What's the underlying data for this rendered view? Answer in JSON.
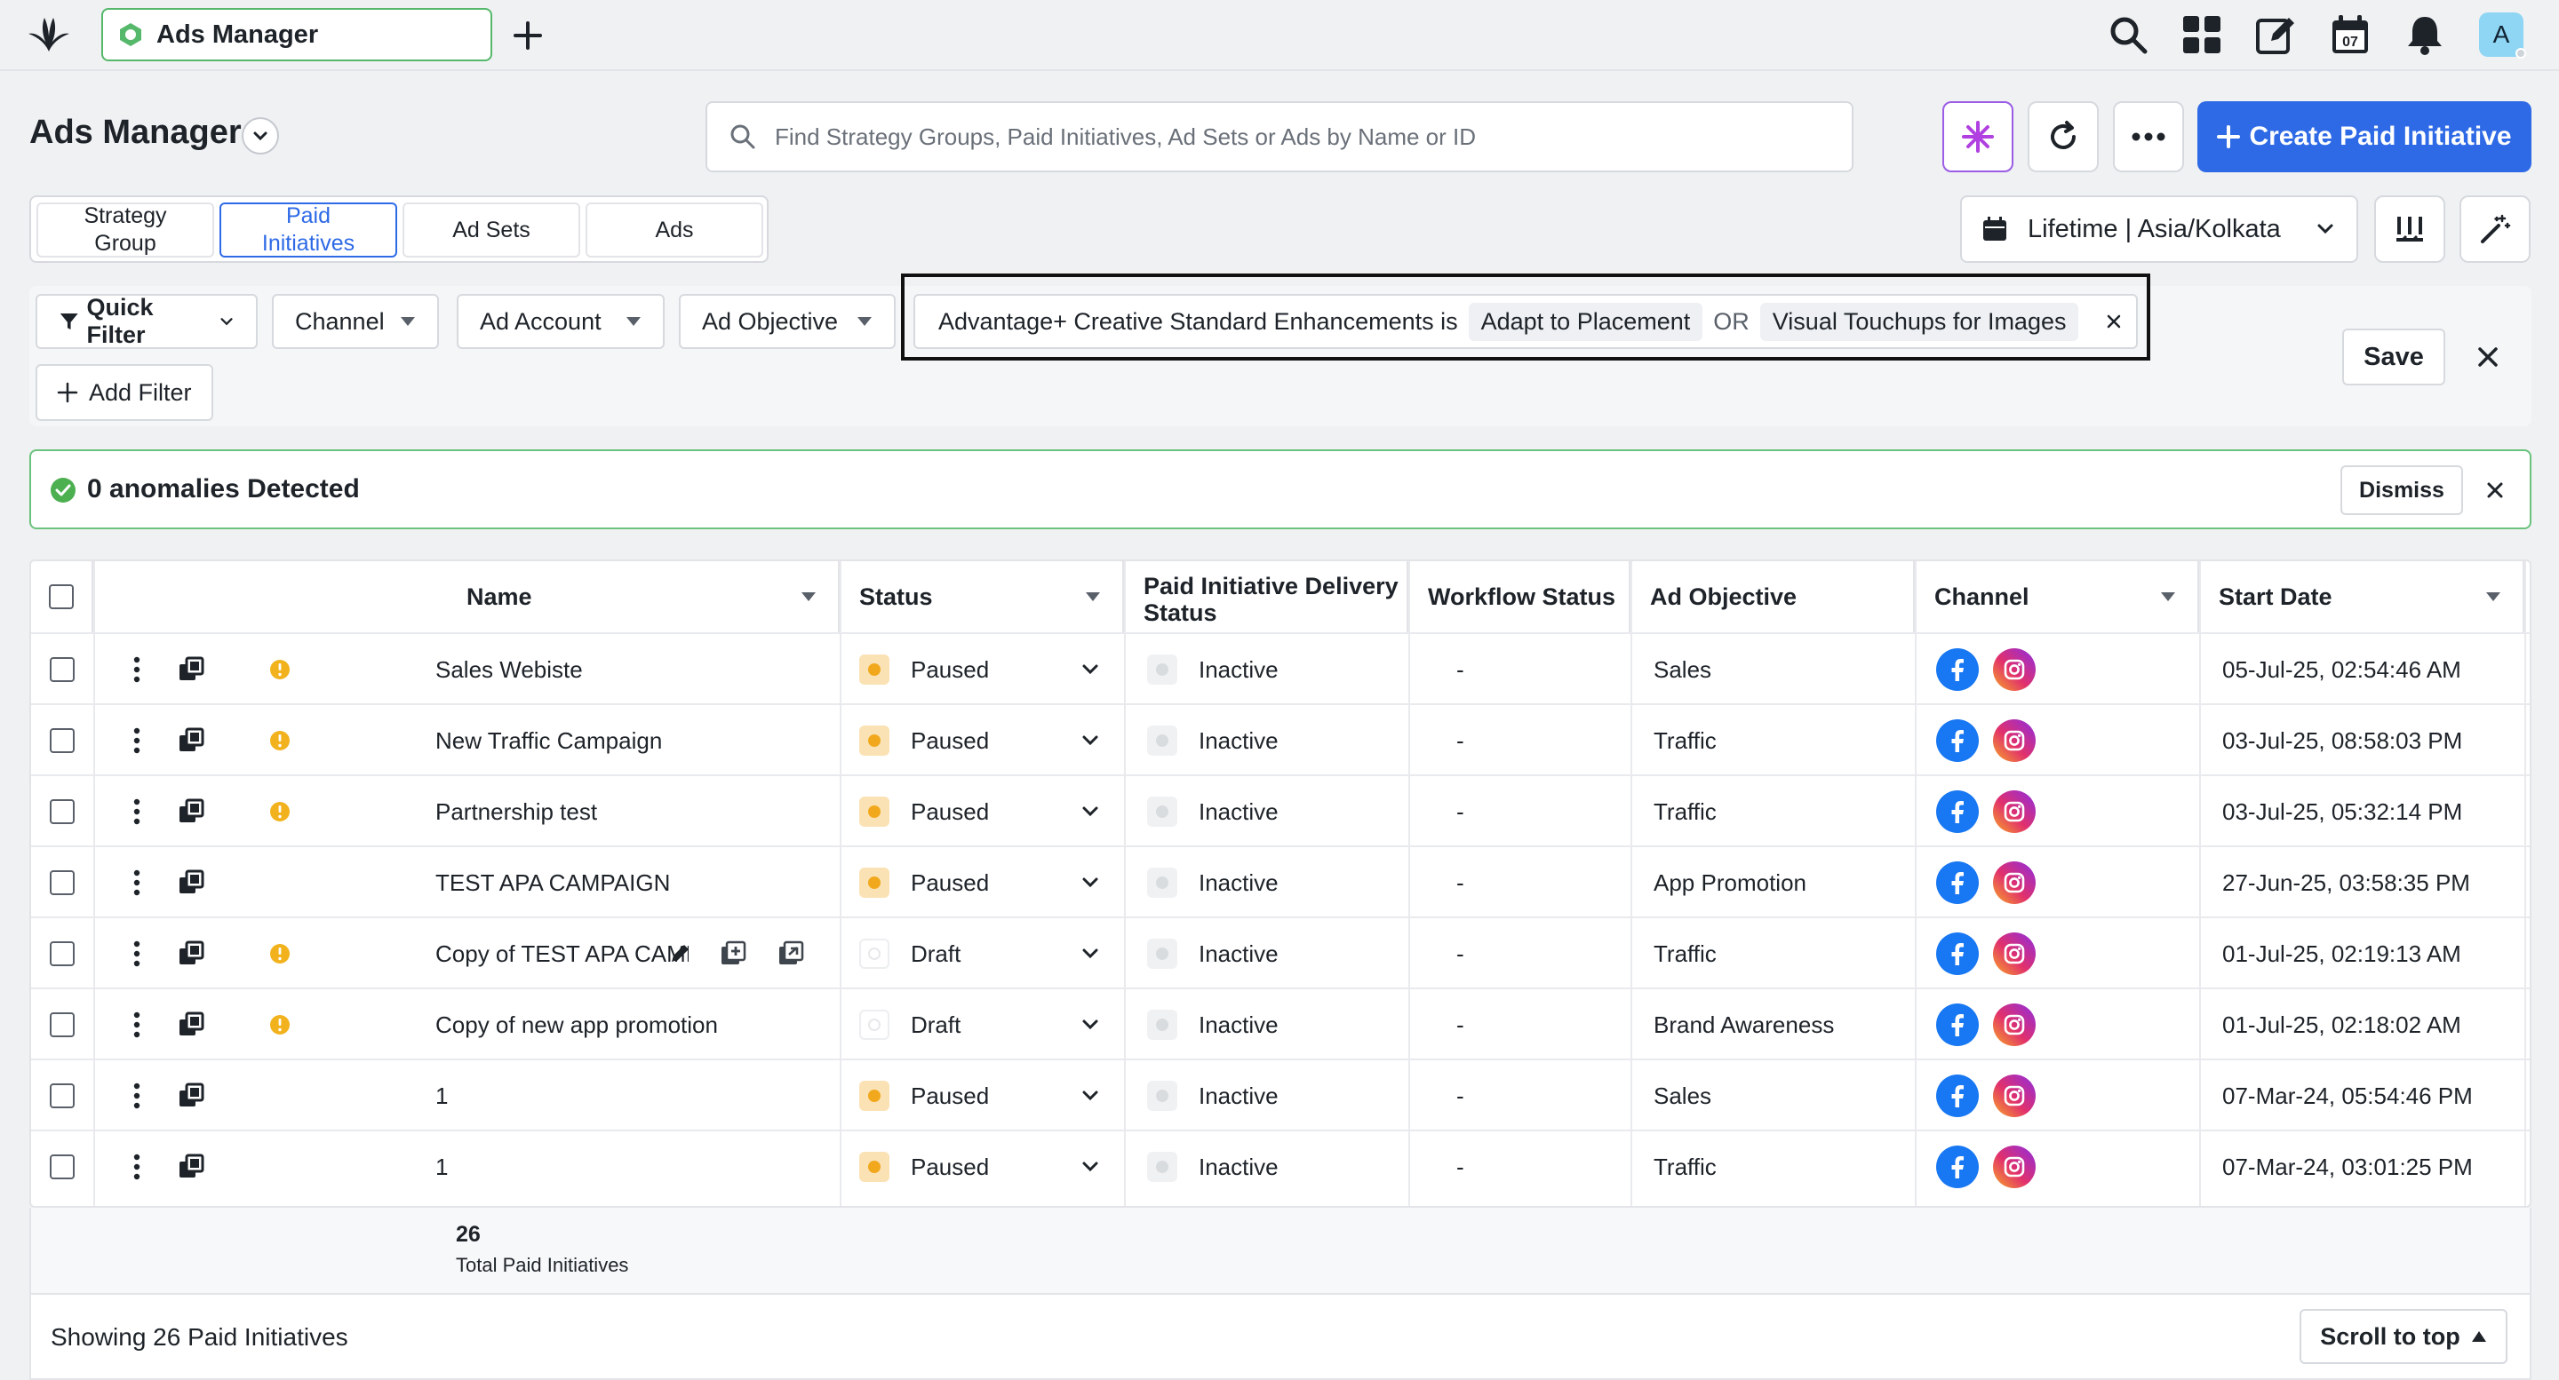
{
  "app": {
    "tab_title": "Ads Manager",
    "avatar_letter": "A",
    "calendar_day": "07"
  },
  "header": {
    "page_title": "Ads Manager",
    "search_placeholder": "Find Strategy Groups, Paid Initiatives, Ad Sets or Ads by Name or ID",
    "create_label": "Create Paid Initiative"
  },
  "level_tabs": [
    {
      "label": "Strategy Group",
      "active": false
    },
    {
      "label": "Paid Initiatives",
      "active": true
    },
    {
      "label": "Ad Sets",
      "active": false
    },
    {
      "label": "Ads",
      "active": false
    }
  ],
  "date_range": "Lifetime | Asia/Kolkata",
  "filters": {
    "quick_filter": "Quick Filter",
    "channel": "Channel",
    "ad_account": "Ad Account",
    "ad_objective": "Ad Objective",
    "condition_field": "Advantage+ Creative Standard Enhancements is",
    "value_1": "Adapt to Placement",
    "operator": "OR",
    "value_2": "Visual Touchups for Images",
    "add_filter": "Add Filter",
    "save": "Save"
  },
  "anomaly": {
    "text": "0 anomalies Detected",
    "dismiss": "Dismiss"
  },
  "table": {
    "headers": {
      "name": "Name",
      "status": "Status",
      "delivery": "Paid Initiative Delivery Status",
      "workflow": "Workflow Status",
      "objective": "Ad Objective",
      "channel": "Channel",
      "start": "Start Date"
    },
    "rows": [
      {
        "name": "Sales Webiste",
        "warn": true,
        "status": "Paused",
        "delivery": "Inactive",
        "workflow": "-",
        "objective": "Sales",
        "start": "05-Jul-25, 02:54:46 AM"
      },
      {
        "name": "New Traffic Campaign",
        "warn": true,
        "status": "Paused",
        "delivery": "Inactive",
        "workflow": "-",
        "objective": "Traffic",
        "start": "03-Jul-25, 08:58:03 PM"
      },
      {
        "name": "Partnership test",
        "warn": true,
        "status": "Paused",
        "delivery": "Inactive",
        "workflow": "-",
        "objective": "Traffic",
        "start": "03-Jul-25, 05:32:14 PM"
      },
      {
        "name": "TEST APA CAMPAIGN",
        "warn": false,
        "status": "Paused",
        "delivery": "Inactive",
        "workflow": "-",
        "objective": "App Promotion",
        "start": "27-Jun-25, 03:58:35 PM"
      },
      {
        "name": "Copy of TEST APA CAMPAIGN",
        "warn": true,
        "status": "Draft",
        "delivery": "Inactive",
        "workflow": "-",
        "objective": "Traffic",
        "start": "01-Jul-25, 02:19:13 AM",
        "hover": true
      },
      {
        "name": "Copy of new app promotion",
        "warn": true,
        "status": "Draft",
        "delivery": "Inactive",
        "workflow": "-",
        "objective": "Brand Awareness",
        "start": "01-Jul-25, 02:18:02 AM"
      },
      {
        "name": "1",
        "warn": false,
        "status": "Paused",
        "delivery": "Inactive",
        "workflow": "-",
        "objective": "Sales",
        "start": "07-Mar-24, 05:54:46 PM"
      },
      {
        "name": "1",
        "warn": false,
        "status": "Paused",
        "delivery": "Inactive",
        "workflow": "-",
        "objective": "Traffic",
        "start": "07-Mar-24, 03:01:25 PM"
      }
    ],
    "summary_count": "26",
    "summary_label": "Total Paid Initiatives"
  },
  "footer": {
    "showing": "Showing 26 Paid Initiatives",
    "scroll_top": "Scroll to top"
  },
  "colors": {
    "accent": "#2e6ae6",
    "success": "#4caf50",
    "warning": "#f2b21d",
    "ai": "#9b5de5"
  }
}
